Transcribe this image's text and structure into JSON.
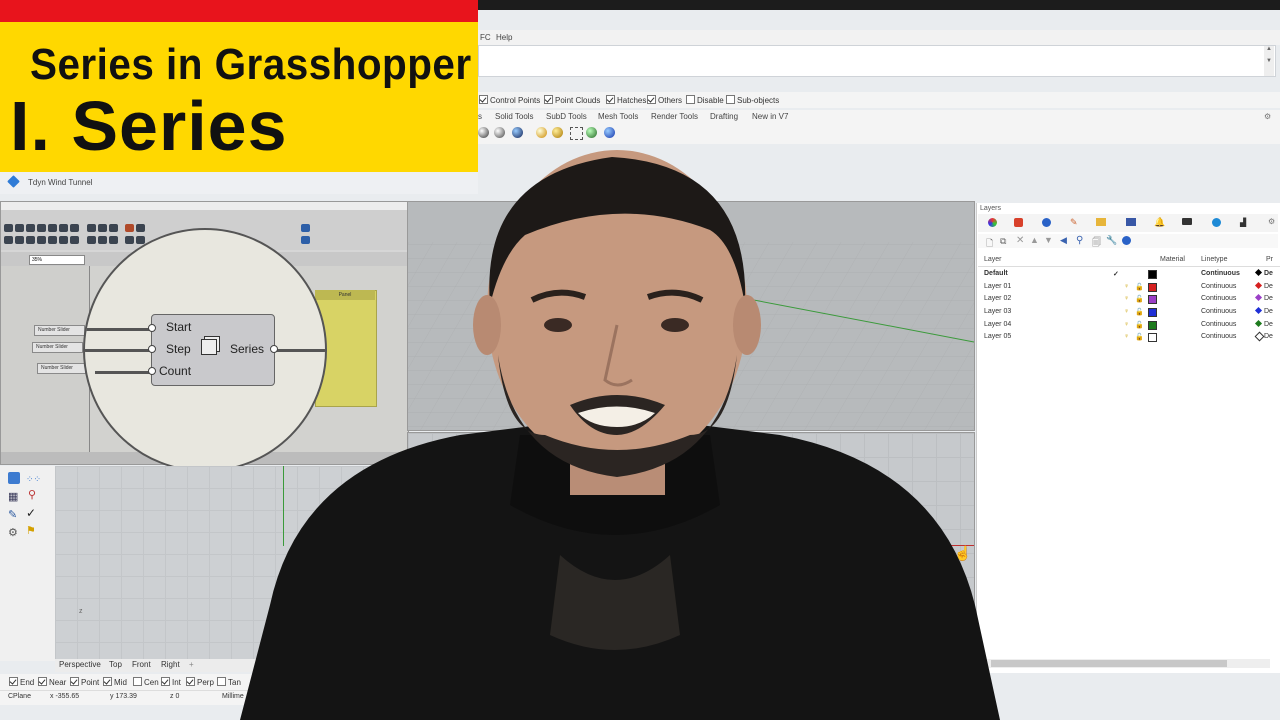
{
  "banner": {
    "title_line1": "Series in Grasshopper",
    "title_line2": "I. Series"
  },
  "rhino": {
    "menu": {
      "partial_item": "FC",
      "help": "Help"
    },
    "filters": [
      {
        "label": "Control Points",
        "checked": true
      },
      {
        "label": "Point Clouds",
        "checked": true
      },
      {
        "label": "Hatches",
        "checked": true
      },
      {
        "label": "Others",
        "checked": true
      },
      {
        "label": "Disable",
        "checked": false
      },
      {
        "label": "Sub-objects",
        "checked": false
      }
    ],
    "tabs": [
      "s",
      "Solid Tools",
      "SubD Tools",
      "Mesh Tools",
      "Render Tools",
      "Drafting",
      "New in V7"
    ],
    "file_tab": "Tdyn Wind Tunnel",
    "viewport_tabs": [
      "Perspective",
      "Top",
      "Front",
      "Right"
    ],
    "osnaps": [
      {
        "label": "End",
        "checked": true
      },
      {
        "label": "Near",
        "checked": true
      },
      {
        "label": "Point",
        "checked": true
      },
      {
        "label": "Mid",
        "checked": true
      },
      {
        "label": "Cen",
        "checked": false
      },
      {
        "label": "Int",
        "checked": true
      },
      {
        "label": "Perp",
        "checked": true
      },
      {
        "label": "Tan",
        "checked": false
      }
    ],
    "status": {
      "cplane": "CPlane",
      "x": "x -355.65",
      "y": "y 173.39",
      "z": "z 0",
      "units": "Millime"
    }
  },
  "grasshopper": {
    "zoom": "35%",
    "panel_title": "Panel",
    "sliders": [
      "Number Slider",
      "Number Slider",
      "Number Slider"
    ],
    "component": {
      "inputs": [
        "Start",
        "Step",
        "Count"
      ],
      "output": "Series"
    }
  },
  "layers": {
    "title": "Layers",
    "columns": {
      "layer": "Layer",
      "material": "Material",
      "linetype": "Linetype",
      "print": "Pr"
    },
    "rows": [
      {
        "name": "Default",
        "current": true,
        "color": "#000000",
        "linetype": "Continuous",
        "print": "De"
      },
      {
        "name": "Layer 01",
        "current": false,
        "color": "#d62020",
        "linetype": "Continuous",
        "print": "De"
      },
      {
        "name": "Layer 02",
        "current": false,
        "color": "#9b3fc7",
        "linetype": "Continuous",
        "print": "De"
      },
      {
        "name": "Layer 03",
        "current": false,
        "color": "#1f2fd6",
        "linetype": "Continuous",
        "print": "De"
      },
      {
        "name": "Layer 04",
        "current": false,
        "color": "#1d7a1d",
        "linetype": "Continuous",
        "print": "De"
      },
      {
        "name": "Layer 05",
        "current": false,
        "color": "#ffffff",
        "linetype": "Continuous",
        "print": "De"
      }
    ]
  }
}
